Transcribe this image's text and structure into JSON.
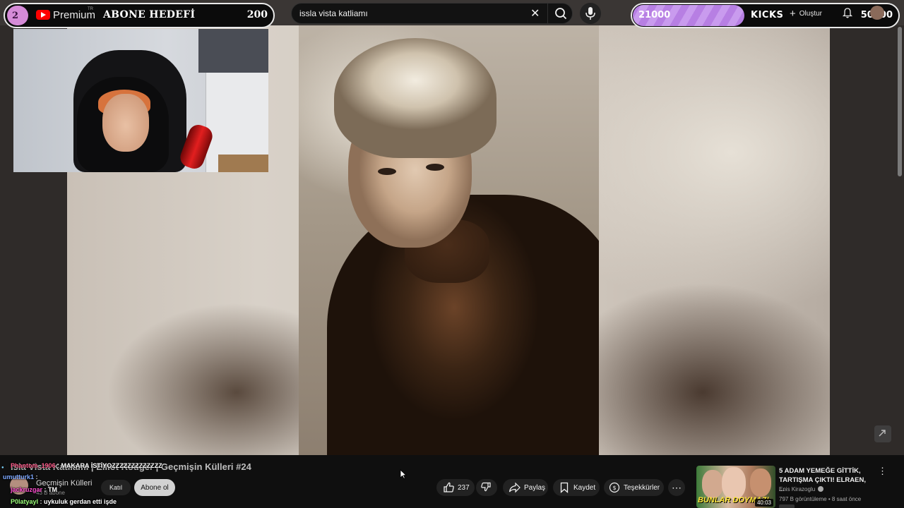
{
  "goal_left": {
    "count": "2",
    "premium_label": "Premium",
    "region": "TR",
    "title": "ABONE HEDEFİ",
    "value": "200"
  },
  "search": {
    "query": "issla vista katliamı"
  },
  "goal_right": {
    "current": "21000",
    "brand": "KICKS",
    "target": "50000",
    "progress_fraction": 0.42,
    "fill_color": "#b77fe3"
  },
  "header": {
    "create_label": "Oluştur"
  },
  "video": {
    "title": "Isla Vista Katliamı | Elliot Rodger | Geçmişin Külleri #24",
    "channel": "Geçmişin Külleri",
    "subscribers": "43 B abone",
    "join_label": "Katıl",
    "subscribe_label": "Abone ol",
    "likes": "237",
    "share_label": "Paylaş",
    "save_label": "Kaydet",
    "thanks_label": "Teşekkürler"
  },
  "chat": [
    {
      "user": "Phantom_1906",
      "text": "MAKARA İSTİYOZZZZZZZZZZZZZ",
      "user_color": "#ff5b8a"
    },
    {
      "user": "umutturk1",
      "text": "",
      "user_color": "#7da8ff"
    },
    {
      "user": "jackruzgar",
      "text": "TM",
      "user_color": "#ff4fd1"
    },
    {
      "user": "P0latyayl",
      "text": "uykuluk gerdan etti işde",
      "user_color": "#9cff7a"
    }
  ],
  "recommended": {
    "title": "5 ADAM YEMEĞE GİTTİK, TARTIŞMA ÇIKTI! ELRAEN, ...",
    "channel": "Enis Kirazoglu",
    "meta": "797 B görüntüleme • 8 saat önce",
    "duration": "40:03",
    "thumb_text": "BUNLAR DOYMAZ!"
  }
}
